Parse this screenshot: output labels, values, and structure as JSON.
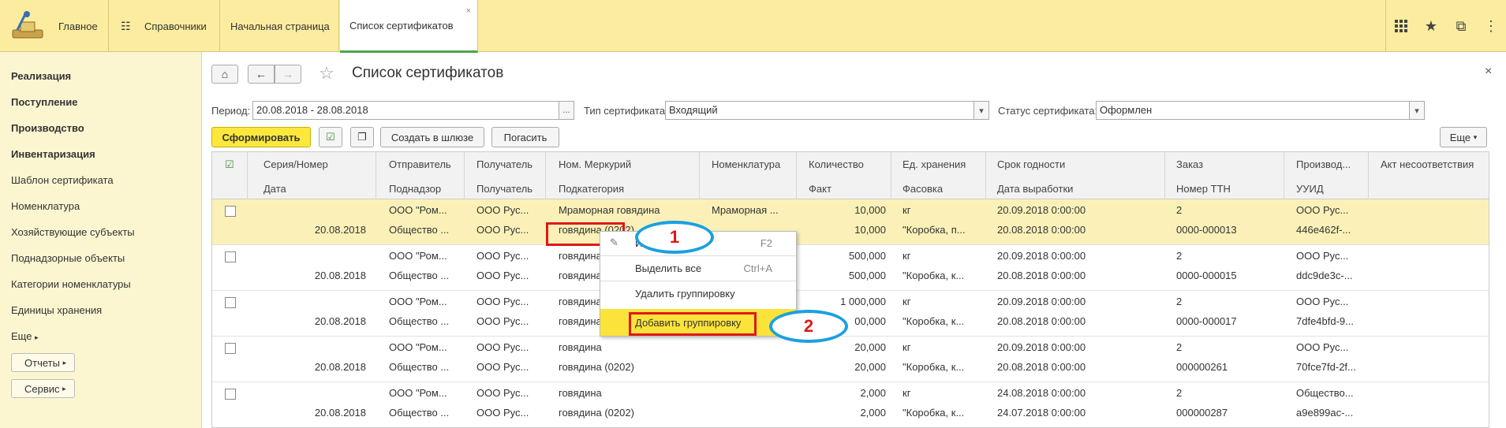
{
  "topbar": {
    "main_label": "Главное",
    "tabs": [
      {
        "label": "Справочники"
      },
      {
        "label": "Начальная страница"
      },
      {
        "label": "Список сертификатов"
      }
    ],
    "close_glyph": "×"
  },
  "sidebar": {
    "sections": [
      "Реализация",
      "Поступление",
      "Производство",
      "Инвентаризация"
    ],
    "items": [
      "Шаблон сертификата",
      "Номенклатура",
      "Хозяйствующие субъекты",
      "Поднадзорные объекты",
      "Категории номенклатуры",
      "Единицы хранения"
    ],
    "more": "Еще",
    "reports": "Отчеты",
    "service": "Сервис"
  },
  "page": {
    "title": "Список сертификатов",
    "close_glyph": "×"
  },
  "filters": {
    "period_label": "Период:",
    "period_value": "20.08.2018 - 28.08.2018",
    "ellipsis": "...",
    "type_label": "Тип сертификата:",
    "type_value": "Входящий",
    "status_label": "Статус сертификата:",
    "status_value": "Оформлен"
  },
  "toolbar": {
    "form_button": "Сформировать",
    "create_gateway": "Создать в шлюзе",
    "repay": "Погасить",
    "more": "Еще"
  },
  "table": {
    "headers_top": [
      "Серия/Номер",
      "Отправитель",
      "Получатель",
      "Ном. Меркурий",
      "Номенклатура",
      "Количество",
      "Ед. хранения",
      "Срок годности",
      "Заказ",
      "Производ...",
      "Акт несоответствия"
    ],
    "headers_bottom": [
      "Дата",
      "Поднадзор",
      "Получатель",
      "Подкатегория",
      "",
      "Факт",
      "Фасовка",
      "Дата выработки",
      "Номер ТТН",
      "УУИД",
      ""
    ],
    "rows": [
      {
        "top": [
          "",
          "ООО \"Ром...",
          "ООО Рус...",
          "Мраморная говядина",
          "Мраморная ...",
          "10,000",
          "кг",
          "20.09.2018 0:00:00",
          "2",
          "ООО Рус..."
        ],
        "bottom": [
          "20.08.2018",
          "Общество ...",
          "ООО Рус...",
          "говядина (0202)",
          "",
          "10,000",
          "\"Коробка, п...",
          "20.08.2018 0:00:00",
          "0000-000013",
          "446e462f-..."
        ]
      },
      {
        "top": [
          "",
          "ООО \"Ром...",
          "ООО Рус...",
          "говядина",
          "",
          "500,000",
          "кг",
          "20.09.2018 0:00:00",
          "2",
          "ООО Рус..."
        ],
        "bottom": [
          "20.08.2018",
          "Общество ...",
          "ООО Рус...",
          "говядина",
          "",
          "500,000",
          "\"Коробка, к...",
          "20.08.2018 0:00:00",
          "0000-000015",
          "ddc9de3c-..."
        ]
      },
      {
        "top": [
          "",
          "ООО \"Ром...",
          "ООО Рус...",
          "говядина",
          "",
          "1 000,000",
          "кг",
          "20.09.2018 0:00:00",
          "2",
          "ООО Рус..."
        ],
        "bottom": [
          "20.08.2018",
          "Общество ...",
          "ООО Рус...",
          "говядина",
          "",
          "00,000",
          "\"Коробка, к...",
          "20.08.2018 0:00:00",
          "0000-000017",
          "7dfe4bfd-9..."
        ]
      },
      {
        "top": [
          "",
          "ООО \"Ром...",
          "ООО Рус...",
          "говядина",
          "",
          "20,000",
          "кг",
          "20.09.2018 0:00:00",
          "2",
          "ООО Рус..."
        ],
        "bottom": [
          "20.08.2018",
          "Общество ...",
          "ООО Рус...",
          "говядина (0202)",
          "",
          "20,000",
          "\"Коробка, к...",
          "20.08.2018 0:00:00",
          "000000261",
          "70fce7fd-2f..."
        ]
      },
      {
        "top": [
          "",
          "ООО \"Ром...",
          "ООО Рус...",
          "говядина",
          "",
          "2,000",
          "кг",
          "24.08.2018 0:00:00",
          "2",
          "Общество..."
        ],
        "bottom": [
          "20.08.2018",
          "Общество ...",
          "ООО Рус...",
          "говядина (0202)",
          "",
          "2,000",
          "\"Коробка, к...",
          "24.07.2018 0:00:00",
          "000000287",
          "a9e899ac-..."
        ]
      }
    ]
  },
  "context_menu": {
    "items": [
      {
        "label": "Из...",
        "shortcut": "F2"
      },
      {
        "label": "Выделить все",
        "shortcut": "Ctrl+A"
      },
      {
        "label": "Удалить группировку",
        "shortcut": ""
      },
      {
        "label": "Добавить группировку",
        "shortcut": ""
      }
    ]
  },
  "annotations": {
    "marker1": "1",
    "marker2": "2"
  }
}
